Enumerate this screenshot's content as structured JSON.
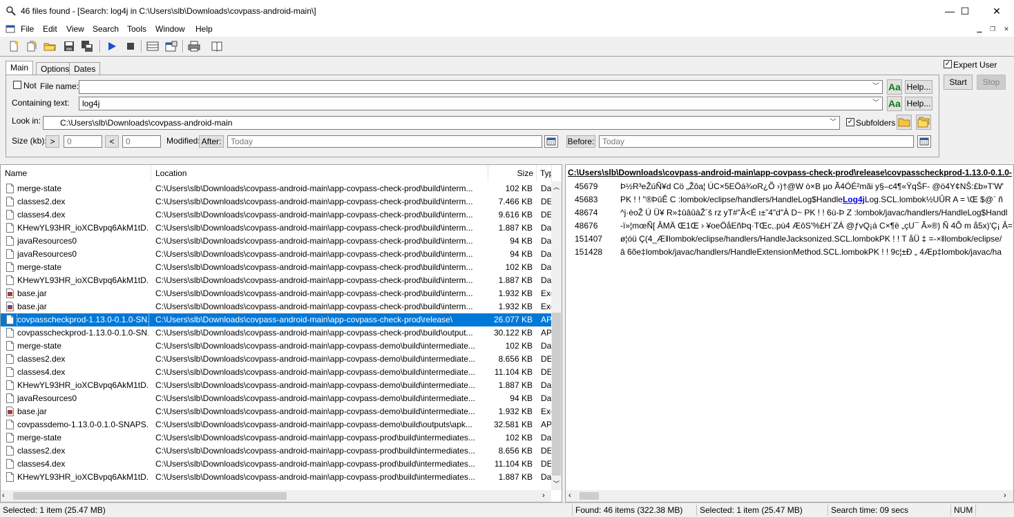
{
  "window": {
    "title": "46 files found - [Search: log4j in C:\\Users\\slb\\Downloads\\covpass-android-main\\]",
    "minimize": "—",
    "maximize": "☐",
    "close": "✕"
  },
  "menu": [
    "File",
    "Edit",
    "View",
    "Search",
    "Tools",
    "Window",
    "Help"
  ],
  "toolbar": {
    "icons": [
      "new-search-icon",
      "new-window-icon",
      "open-icon",
      "save-icon",
      "save-all-icon",
      "start-icon",
      "stop-icon",
      "layout-icon",
      "properties-icon",
      "print-icon",
      "help-book-icon"
    ]
  },
  "tabs": [
    "Main",
    "Options",
    "Dates"
  ],
  "form": {
    "not_label": "Not",
    "filename_label": "File name:",
    "filename_value": "",
    "containing_label": "Containing text:",
    "containing_value": "log4j",
    "lookin_label": "Look in:",
    "lookin_value": "C:\\Users\\slb\\Downloads\\covpass-android-main",
    "subfolders_label": "Subfolders",
    "subfolders_checked": true,
    "size_label": "Size (kb):",
    "size_gt": ">",
    "size_gt_value": "0",
    "size_lt": "<",
    "size_lt_value": "0",
    "modified_label": "Modified:",
    "after_label": "After:",
    "after_value": "Today",
    "before_label": "Before:",
    "before_value": "Today",
    "aa_label": "Aa",
    "help_label": "Help..."
  },
  "right": {
    "expert_label": "Expert User",
    "expert_checked": true,
    "start": "Start",
    "stop": "Stop"
  },
  "results": {
    "columns": [
      "Name",
      "Location",
      "Size",
      "Typ"
    ],
    "rows": [
      {
        "name": "merge-state",
        "loc": "C:\\Users\\slb\\Downloads\\covpass-android-main\\app-covpass-check-prod\\build\\interm...",
        "size": "102 KB",
        "type": "Da",
        "icon": "file"
      },
      {
        "name": "classes2.dex",
        "loc": "C:\\Users\\slb\\Downloads\\covpass-android-main\\app-covpass-check-prod\\build\\interm...",
        "size": "7.466 KB",
        "type": "DE",
        "icon": "file"
      },
      {
        "name": "classes4.dex",
        "loc": "C:\\Users\\slb\\Downloads\\covpass-android-main\\app-covpass-check-prod\\build\\interm...",
        "size": "9.616 KB",
        "type": "DE",
        "icon": "file"
      },
      {
        "name": "KHewYL93HR_ioXCBvpq6AkM1tD...",
        "loc": "C:\\Users\\slb\\Downloads\\covpass-android-main\\app-covpass-check-prod\\build\\interm...",
        "size": "1.887 KB",
        "type": "Da",
        "icon": "file"
      },
      {
        "name": "javaResources0",
        "loc": "C:\\Users\\slb\\Downloads\\covpass-android-main\\app-covpass-check-prod\\build\\interm...",
        "size": "94 KB",
        "type": "Da",
        "icon": "file"
      },
      {
        "name": "javaResources0",
        "loc": "C:\\Users\\slb\\Downloads\\covpass-android-main\\app-covpass-check-prod\\build\\interm...",
        "size": "94 KB",
        "type": "Da",
        "icon": "file"
      },
      {
        "name": "merge-state",
        "loc": "C:\\Users\\slb\\Downloads\\covpass-android-main\\app-covpass-check-prod\\build\\interm...",
        "size": "102 KB",
        "type": "Da",
        "icon": "file"
      },
      {
        "name": "KHewYL93HR_ioXCBvpq6AkM1tD...",
        "loc": "C:\\Users\\slb\\Downloads\\covpass-android-main\\app-covpass-check-prod\\build\\interm...",
        "size": "1.887 KB",
        "type": "Da",
        "icon": "file"
      },
      {
        "name": "base.jar",
        "loc": "C:\\Users\\slb\\Downloads\\covpass-android-main\\app-covpass-check-prod\\build\\interm...",
        "size": "1.932 KB",
        "type": "Exe",
        "icon": "jar"
      },
      {
        "name": "base.jar",
        "loc": "C:\\Users\\slb\\Downloads\\covpass-android-main\\app-covpass-check-prod\\build\\interm...",
        "size": "1.932 KB",
        "type": "Exe",
        "icon": "jar"
      },
      {
        "name": "covpasscheckprod-1.13.0-0.1.0-SN...",
        "loc": "C:\\Users\\slb\\Downloads\\covpass-android-main\\app-covpass-check-prod\\release\\",
        "size": "26.077 KB",
        "type": "AP",
        "icon": "file",
        "selected": true
      },
      {
        "name": "covpasscheckprod-1.13.0-0.1.0-SN...",
        "loc": "C:\\Users\\slb\\Downloads\\covpass-android-main\\app-covpass-check-prod\\build\\output...",
        "size": "30.122 KB",
        "type": "AP",
        "icon": "file"
      },
      {
        "name": "merge-state",
        "loc": "C:\\Users\\slb\\Downloads\\covpass-android-main\\app-covpass-demo\\build\\intermediate...",
        "size": "102 KB",
        "type": "Da",
        "icon": "file"
      },
      {
        "name": "classes2.dex",
        "loc": "C:\\Users\\slb\\Downloads\\covpass-android-main\\app-covpass-demo\\build\\intermediate...",
        "size": "8.656 KB",
        "type": "DE",
        "icon": "file"
      },
      {
        "name": "classes4.dex",
        "loc": "C:\\Users\\slb\\Downloads\\covpass-android-main\\app-covpass-demo\\build\\intermediate...",
        "size": "11.104 KB",
        "type": "DE",
        "icon": "file"
      },
      {
        "name": "KHewYL93HR_ioXCBvpq6AkM1tD...",
        "loc": "C:\\Users\\slb\\Downloads\\covpass-android-main\\app-covpass-demo\\build\\intermediate...",
        "size": "1.887 KB",
        "type": "Da",
        "icon": "file"
      },
      {
        "name": "javaResources0",
        "loc": "C:\\Users\\slb\\Downloads\\covpass-android-main\\app-covpass-demo\\build\\intermediate...",
        "size": "94 KB",
        "type": "Da",
        "icon": "file"
      },
      {
        "name": "base.jar",
        "loc": "C:\\Users\\slb\\Downloads\\covpass-android-main\\app-covpass-demo\\build\\intermediate...",
        "size": "1.932 KB",
        "type": "Exe",
        "icon": "jar"
      },
      {
        "name": "covpassdemo-1.13.0-0.1.0-SNAPS...",
        "loc": "C:\\Users\\slb\\Downloads\\covpass-android-main\\app-covpass-demo\\build\\outputs\\apk...",
        "size": "32.581 KB",
        "type": "AP",
        "icon": "file"
      },
      {
        "name": "merge-state",
        "loc": "C:\\Users\\slb\\Downloads\\covpass-android-main\\app-covpass-prod\\build\\intermediates...",
        "size": "102 KB",
        "type": "Da",
        "icon": "file"
      },
      {
        "name": "classes2.dex",
        "loc": "C:\\Users\\slb\\Downloads\\covpass-android-main\\app-covpass-prod\\build\\intermediates...",
        "size": "8.656 KB",
        "type": "DE",
        "icon": "file"
      },
      {
        "name": "classes4.dex",
        "loc": "C:\\Users\\slb\\Downloads\\covpass-android-main\\app-covpass-prod\\build\\intermediates...",
        "size": "11.104 KB",
        "type": "DE",
        "icon": "file"
      },
      {
        "name": "KHewYL93HR_ioXCBvpq6AkM1tD...",
        "loc": "C:\\Users\\slb\\Downloads\\covpass-android-main\\app-covpass-prod\\build\\intermediates...",
        "size": "1.887 KB",
        "type": "Da",
        "icon": "file"
      }
    ]
  },
  "preview": {
    "path": "C:\\Users\\slb\\Downloads\\covpass-android-main\\app-covpass-check-prod\\release\\covpasscheckprod-1.13.0-0.1.0-",
    "lines": [
      {
        "num": "45679",
        "pre": "Þ½R³eŽúÑ¥d Cö „Žôa¦ ÚC×5EÖá¾oR¿Õ ›)†@W ò×B µo Ã4ÓÉ²mãi y§–c4¶«ŸqŠF- @ö4Y¢NŠ:£b»T'W'",
        "hl": "",
        "post": ""
      },
      {
        "num": "45683",
        "pre": "PK ! ! \"®ÞûÊ C :lombok/eclipse/handlers/HandleLog$Handle",
        "hl": "Log4j",
        "post": "Log.SCL.lombok½UÛR A = \\Œ  $@` ñ"
      },
      {
        "num": "48674",
        "pre": "^j·èoŽ Ú Ü¥ R»‡ûâûàŽ´š rz yT#\"Â<É ı±˜4\"d\"À D~ PK ! !  6ù-Þ Z :lombok/javac/handlers/HandleLog$Handl",
        "hl": "",
        "post": ""
      },
      {
        "num": "48676",
        "pre": "-ï»¦mœÑ[ ÂMÄ Œ1Œ › ¥oeÖåEñÞq·TŒc,.pù4 ÆôS'%£H´ZÁ @ƒvQ¡á C×¶ë „çU¯ Ã»®) Ñ 4Õ m å5x)'Ç¡ Â=Ÿ",
        "hl": "",
        "post": ""
      },
      {
        "num": "151407",
        "pre": "ø¦óü Ç(4_Æ‖lombok/eclipse/handlers/HandleJacksonized.SCL.lombokPK ! ! T åÜ ‡ =-×‖lombok/eclipse/",
        "hl": "",
        "post": ""
      },
      {
        "num": "151428",
        "pre": "â 6õe‡lombok/javac/handlers/HandleExtensionMethod.SCL.lombokPK ! ! 9c¦±Ð „ 4Æp‡lombok/javac/ha",
        "hl": "",
        "post": ""
      }
    ]
  },
  "status": {
    "selected_left": "Selected: 1 item (25.47 MB)",
    "found": "Found: 46 items (322.38 MB)",
    "selected_right": "Selected: 1 item (25.47 MB)",
    "search_time": "Search time: 09 secs",
    "num": "NUM"
  },
  "colors": {
    "selection": "#0078d7",
    "aa_green": "#137a13",
    "link_blue": "#0000ee"
  }
}
